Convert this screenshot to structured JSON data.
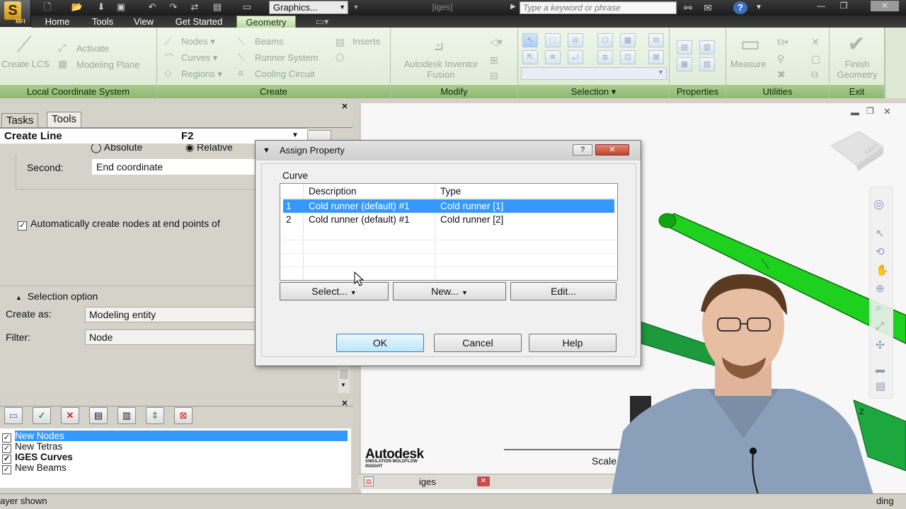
{
  "titlebar": {
    "app_letter": "S",
    "app_badge": "MFI",
    "view_select": "Graphics...",
    "document_title": "[iges]",
    "search_placeholder": "Type a keyword or phrase"
  },
  "ribbon_tabs": [
    "Home",
    "Tools",
    "View",
    "Get Started",
    "Geometry"
  ],
  "ribbon": {
    "lcs": {
      "create_lcs": "Create LCS",
      "activate": "Activate",
      "modeling_plane": "Modeling Plane",
      "label": "Local Coordinate System"
    },
    "create": {
      "nodes": "Nodes",
      "curves": "Curves",
      "regions": "Regions",
      "beams": "Beams",
      "runner_system": "Runner System",
      "cooling_circuit": "Cooling Circuit",
      "inserts": "Inserts",
      "label": "Create"
    },
    "modify": {
      "fusion_line1": "Autodesk Inventor",
      "fusion_line2": "Fusion",
      "label": "Modify"
    },
    "selection": {
      "label": "Selection"
    },
    "properties": {
      "label": "Properties"
    },
    "utilities": {
      "measure": "Measure",
      "label": "Utilities"
    },
    "exit": {
      "finish_line1": "Finish",
      "finish_line2": "Geometry",
      "label": "Exit"
    }
  },
  "left_panel": {
    "tabs": [
      "Tasks",
      "Tools"
    ],
    "tool_name": "Create Line",
    "tool_key": "F2",
    "absolute": "Absolute",
    "relative": "Relative",
    "second_label": "Second:",
    "second_value": "End coordinate",
    "auto_nodes": "Automatically create nodes at end points of",
    "selection_option": "Selection option",
    "create_as_label": "Create as:",
    "create_as_value": "Modeling entity",
    "filter_label": "Filter:",
    "filter_value": "Node"
  },
  "layers": {
    "items": [
      {
        "name": "New Nodes",
        "selected": true,
        "bold": false
      },
      {
        "name": "New Tetras",
        "selected": false,
        "bold": false
      },
      {
        "name": "IGES Curves",
        "selected": false,
        "bold": true
      },
      {
        "name": "New Beams",
        "selected": false,
        "bold": false
      }
    ]
  },
  "status": {
    "left": "ayer shown",
    "right": "ding"
  },
  "viewport": {
    "brand": "Autodesk",
    "brand_sub1": "SIMULATION MOLDFLOW",
    "brand_sub2": "INSIGHT",
    "scale": "Scale",
    "doc_tab": "iges",
    "viewcube_face": "LEFT",
    "axis_label": "Z"
  },
  "dialog": {
    "title": "Assign Property",
    "group": "Curve",
    "columns": [
      "Description",
      "Type"
    ],
    "rows": [
      {
        "num": "1",
        "description": "Cold runner (default) #1",
        "type": "Cold runner [1]",
        "selected": true
      },
      {
        "num": "2",
        "description": "Cold runner (default) #1",
        "type": "Cold runner [2]",
        "selected": false
      }
    ],
    "select_btn": "Select...",
    "new_btn": "New...",
    "edit_btn": "Edit...",
    "ok": "OK",
    "cancel": "Cancel",
    "help": "Help"
  }
}
